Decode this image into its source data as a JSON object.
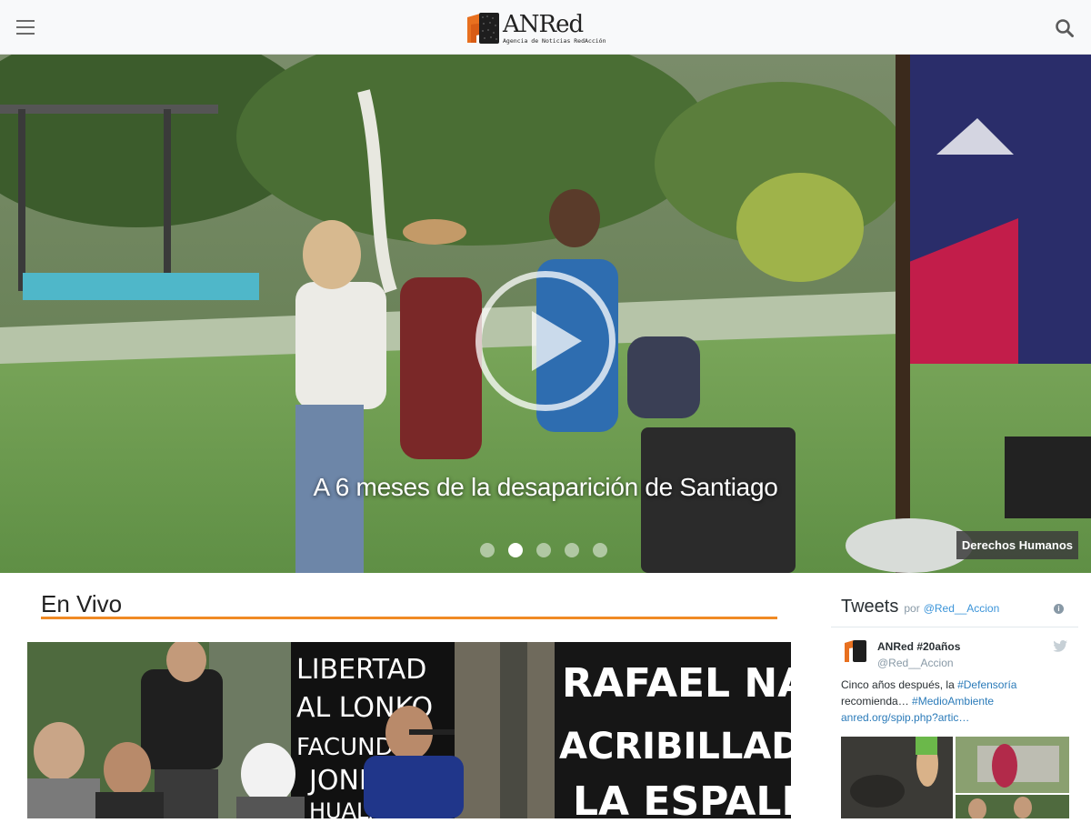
{
  "header": {
    "logo_title": "ANRed",
    "logo_subtitle": "Agencia de Noticias RedAcción",
    "menu_icon": "hamburger-menu-icon",
    "search_icon": "search-icon"
  },
  "hero": {
    "title": "A 6 meses de la desaparición de Santiago",
    "category": "Derechos Humanos",
    "slide_count": 5,
    "active_slide": 2,
    "play_icon": "play-icon"
  },
  "envivo": {
    "title": "En Vivo",
    "accent": "#f08a24",
    "banner_text_left": [
      "LIBERTAD",
      "AL LONKO",
      "FACUNDO",
      "JONES",
      "HUALA"
    ],
    "banner_text_right": [
      "RAFAEL NA",
      "ACRIBILLAD",
      "LA ESPALD"
    ]
  },
  "tweets": {
    "title": "Tweets",
    "by": "por",
    "handle": "@Red__Accion",
    "tweet": {
      "name": "ANRed #20años",
      "user": "@Red__Accion",
      "text_1": "Cinco años después, la ",
      "hashtag_1": "#Defensoría",
      "text_2": "recomienda… ",
      "hashtag_2": "#MedioAmbiente",
      "link": "anred.org/spip.php?artic…"
    }
  }
}
